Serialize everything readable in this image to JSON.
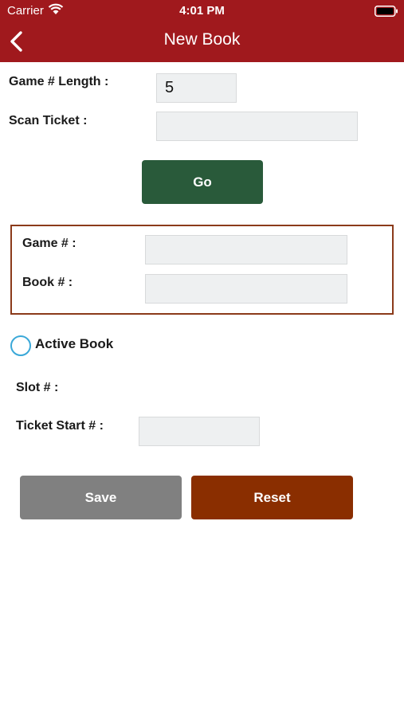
{
  "status_bar": {
    "carrier": "Carrier",
    "time": "4:01 PM"
  },
  "nav": {
    "title": "New Book"
  },
  "form": {
    "game_length": {
      "label": "Game # Length :",
      "value": "5"
    },
    "scan_ticket": {
      "label": "Scan Ticket :",
      "value": ""
    },
    "go_label": "Go",
    "game_number": {
      "label": "Game # :",
      "value": ""
    },
    "book_number": {
      "label": "Book # :",
      "value": ""
    },
    "active_book_label": "Active Book",
    "slot": {
      "label": "Slot # :"
    },
    "ticket_start": {
      "label": "Ticket Start # :",
      "value": ""
    },
    "save_label": "Save",
    "reset_label": "Reset"
  },
  "colors": {
    "header": "#a0191d",
    "go_button": "#295a3a",
    "save_button": "#808080",
    "reset_button": "#8a2e00",
    "box_border": "#8b3a1a",
    "radio_border": "#3aa8d8"
  }
}
